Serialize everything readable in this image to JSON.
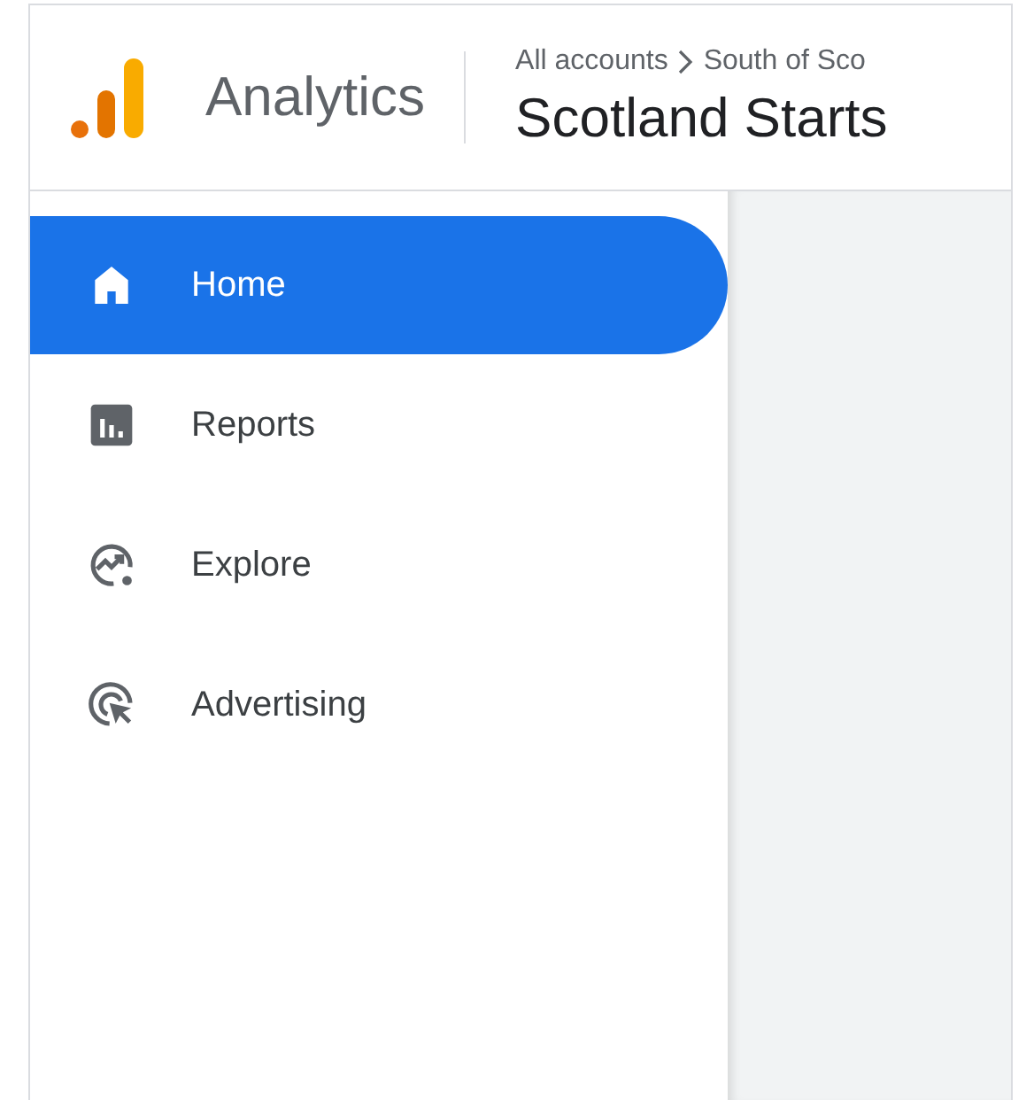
{
  "header": {
    "product": "Analytics",
    "breadcrumb": [
      "All accounts",
      "South of Sco"
    ],
    "property": "Scotland Starts"
  },
  "nav": [
    {
      "label": "Home",
      "kind": "home",
      "selected": true
    },
    {
      "label": "Reports",
      "kind": "reports",
      "selected": false
    },
    {
      "label": "Explore",
      "kind": "explore",
      "selected": false
    },
    {
      "label": "Advertising",
      "kind": "advertising",
      "selected": false
    }
  ]
}
